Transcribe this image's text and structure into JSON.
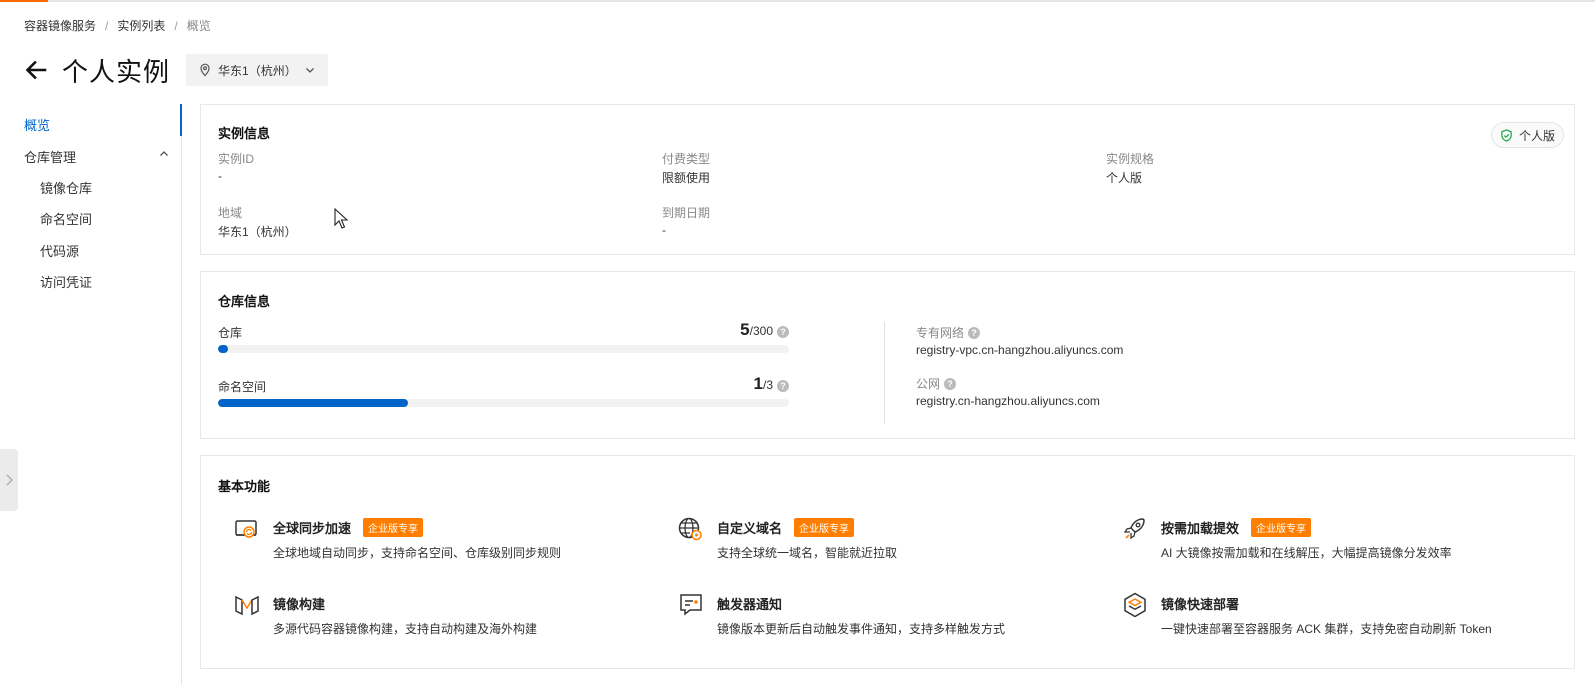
{
  "breadcrumb": {
    "items": [
      "容器镜像服务",
      "实例列表",
      "概览"
    ],
    "separator": "/"
  },
  "header": {
    "title": "个人实例",
    "region": "华东1（杭州）"
  },
  "sidebar": {
    "overview": "概览",
    "repo_mgmt": "仓库管理",
    "sub_items": [
      "镜像仓库",
      "命名空间",
      "代码源",
      "访问凭证"
    ]
  },
  "instance_info": {
    "title": "实例信息",
    "edition_badge": "个人版",
    "fields": [
      {
        "label": "实例ID",
        "value": "-"
      },
      {
        "label": "付费类型",
        "value": "限额使用"
      },
      {
        "label": "实例规格",
        "value": "个人版"
      },
      {
        "label": "地域",
        "value": "华东1（杭州）"
      },
      {
        "label": "到期日期",
        "value": "-"
      }
    ]
  },
  "repo_info": {
    "title": "仓库信息",
    "usage": [
      {
        "label": "仓库",
        "used": "5",
        "total": "/300",
        "fraction": 0.0167
      },
      {
        "label": "命名空间",
        "used": "1",
        "total": "/3",
        "fraction": 0.3333
      }
    ],
    "endpoints": [
      {
        "label": "专有网络",
        "value": "registry-vpc.cn-hangzhou.aliyuncs.com"
      },
      {
        "label": "公网",
        "value": "registry.cn-hangzhou.aliyuncs.com"
      }
    ]
  },
  "features": {
    "title": "基本功能",
    "items": [
      {
        "name": "全球同步加速",
        "tag": "企业版专享",
        "desc": "全球地域自动同步，支持命名空间、仓库级别同步规则",
        "icon": "global-sync-icon"
      },
      {
        "name": "自定义域名",
        "tag": "企业版专享",
        "desc": "支持全球统一域名，智能就近拉取",
        "icon": "custom-domain-icon"
      },
      {
        "name": "按需加载提效",
        "tag": "企业版专享",
        "desc": "AI 大镜像按需加载和在线解压，大幅提高镜像分发效率",
        "icon": "rocket-icon"
      },
      {
        "name": "镜像构建",
        "tag": "",
        "desc": "多源代码容器镜像构建，支持自动构建及海外构建",
        "icon": "build-icon"
      },
      {
        "name": "触发器通知",
        "tag": "",
        "desc": "镜像版本更新后自动触发事件通知，支持多样触发方式",
        "icon": "trigger-icon"
      },
      {
        "name": "镜像快速部署",
        "tag": "",
        "desc": "一键快速部署至容器服务 ACK 集群，支持免密自动刷新 Token",
        "icon": "deploy-icon"
      }
    ]
  },
  "colors": {
    "accent": "#0064c8",
    "tag": "#ff7e00",
    "brand": "#ff6a00"
  }
}
